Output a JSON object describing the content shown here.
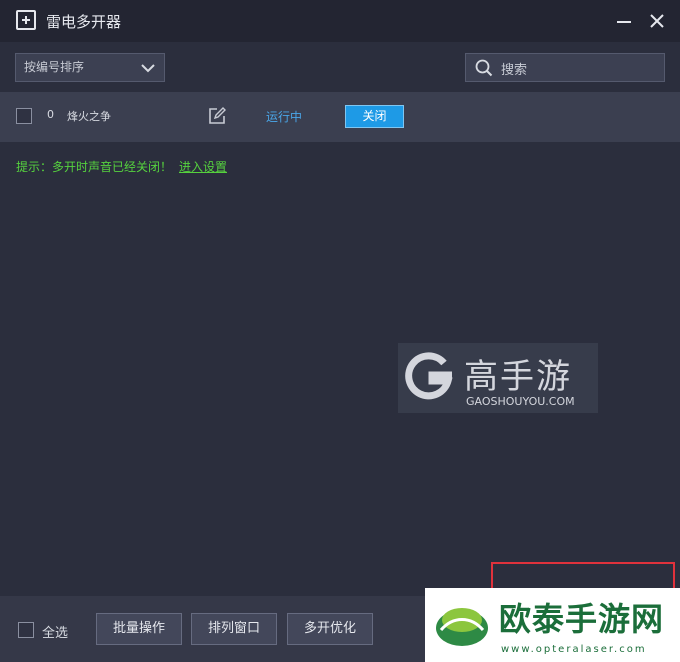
{
  "window": {
    "title": "雷电多开器",
    "icon": "app-add-icon",
    "minimize_icon": "minimize-icon",
    "close_icon": "close-icon"
  },
  "toolbar": {
    "sort_value": "按编号排序",
    "sort_icon": "chevron-down-icon",
    "search_placeholder": "搜索",
    "search_icon": "search-icon"
  },
  "instances": [
    {
      "number": "0",
      "name": "烽火之争",
      "edit_icon": "edit-icon",
      "status": "运行中",
      "action_label": "关闭"
    }
  ],
  "notice": {
    "text": "提示：多开时声音已经关闭！",
    "link": "进入设置"
  },
  "bottom": {
    "select_all": "全选",
    "batch_label": "批量操作",
    "arrange_label": "排列窗口",
    "optimize_label": "多开优化"
  },
  "watermarks": {
    "site1_cn": "高手游",
    "site1_en": "GAOSHOUYOU.COM",
    "site2_cn": "欧泰手游网",
    "site2_en": "www.opteralaser.com"
  },
  "colors": {
    "accent": "#1e9ae6",
    "status": "#4aa6e8",
    "notice": "#56d23e",
    "highlight": "#e0323c"
  }
}
